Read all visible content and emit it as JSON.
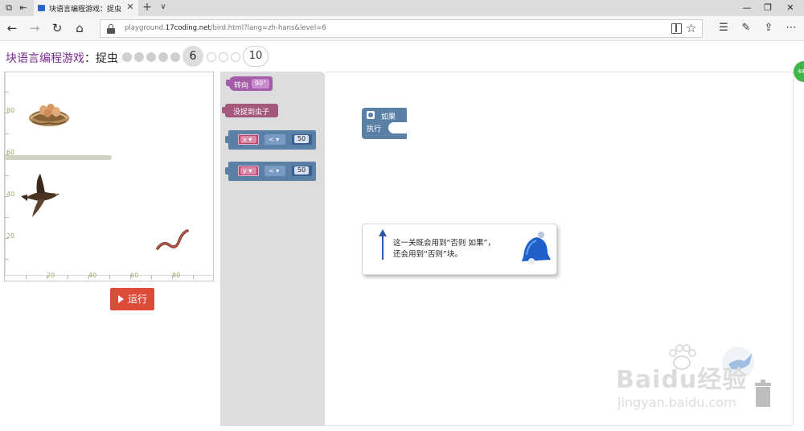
{
  "browser": {
    "tab_title": "块语言编程游戏：捉虫",
    "url_prefix": "playground.",
    "url_domain": "17coding.net",
    "url_rest": "/bird.html?lang=zh-hans&level=6"
  },
  "header": {
    "title": "块语言编程游戏",
    "separator": "：",
    "subtitle": "捉虫",
    "current_level": "6",
    "last_level": "10"
  },
  "stage": {
    "x_ticks": [
      "20",
      "40",
      "60",
      "80"
    ],
    "y_ticks": [
      "80",
      "60",
      "40",
      "20"
    ]
  },
  "run_button": {
    "label": "运行"
  },
  "toolbox": {
    "turn_label": "转向",
    "turn_value": "90°",
    "nobug_label": "没捉到虫子",
    "compare_x": {
      "var": "x ▾",
      "op": "< ▾",
      "value": "50"
    },
    "compare_y": {
      "var": "y ▾",
      "op": "< ▾",
      "value": "50"
    }
  },
  "workspace": {
    "if_label": "如果",
    "do_label": "执行"
  },
  "hint": {
    "line1": "这一关既会用到“否则 如果”，",
    "line2": "还会用到“否则”块。"
  },
  "watermark": {
    "brand": "Baidu经验",
    "url": "jingyan.baidu.com"
  },
  "side_badge": "48"
}
